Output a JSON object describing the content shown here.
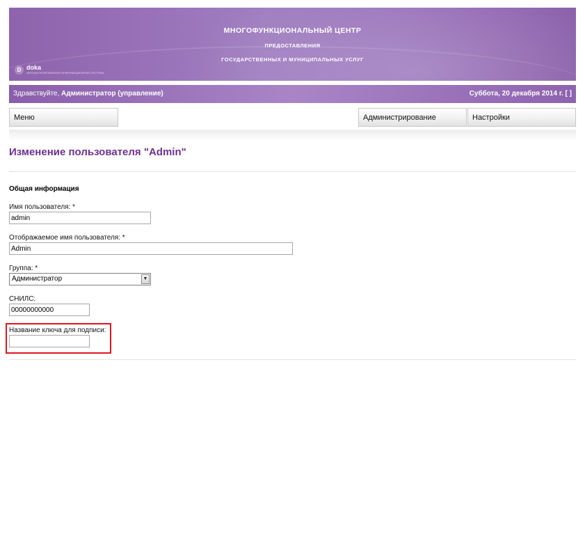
{
  "header": {
    "title_line1": "МНОГОФУНКЦИОНАЛЬНЫЙ ЦЕНТР",
    "title_line2": "ПРЕДОСТАВЛЕНИЯ",
    "title_line3": "ГОСУДАРСТВЕННЫХ И МУНИЦИПАЛЬНЫХ УСЛУГ",
    "logo_mark": "D",
    "logo_name": "doka",
    "logo_subtitle": "АВТОМАТИЗИРОВАННАЯ ИНФОРМАЦИОННАЯ СИСТЕМА"
  },
  "userbar": {
    "greeting": "Здравствуйте,",
    "user": "Администратор (управление)",
    "date": "Суббота, 20 декабря 2014 г. [ ]"
  },
  "nav": {
    "menu": "Меню",
    "administration": "Администрирование",
    "settings": "Настройки"
  },
  "page": {
    "title": "Изменение пользователя \"Admin\"",
    "section": "Общая информация"
  },
  "form": {
    "username_label": "Имя пользователя: *",
    "username_value": "admin",
    "display_name_label": "Отображаемое имя пользователя: *",
    "display_name_value": "Admin",
    "group_label": "Группа: *",
    "group_value": "Администратор",
    "group_arrow": "▼",
    "snils_label": "СНИЛС:",
    "snils_value": "00000000000",
    "key_label": "Название ключа для подписи:",
    "key_value": ""
  },
  "colors": {
    "brand_purple": "#8e63ad",
    "title_purple": "#6f2f91",
    "highlight_red": "#e0141e"
  }
}
